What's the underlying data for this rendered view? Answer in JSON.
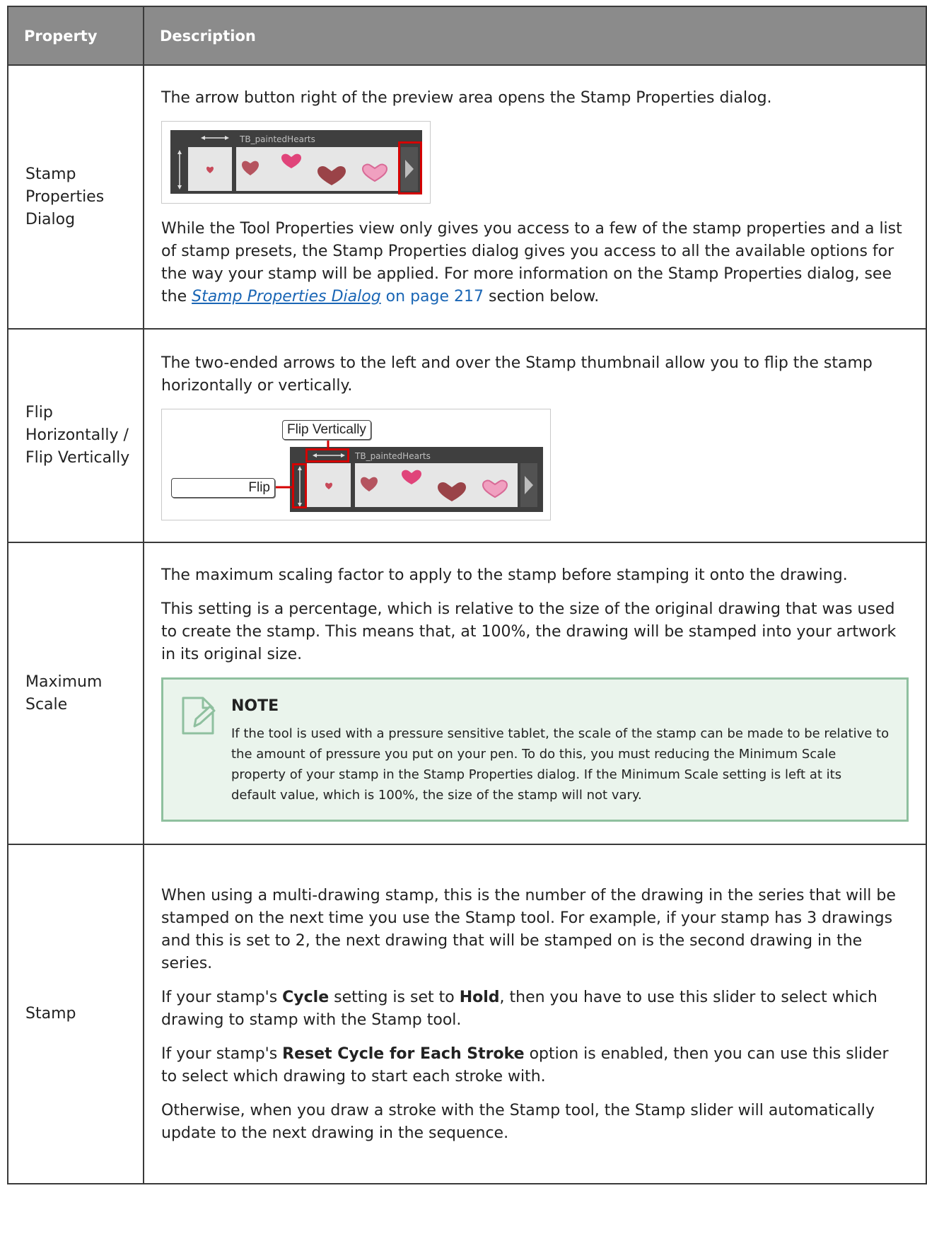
{
  "headers": {
    "property": "Property",
    "description": "Description"
  },
  "rows": [
    {
      "name": "Stamp Properties Dialog",
      "intro": "The arrow button right of the preview area opens the Stamp Properties dialog.",
      "figure_label": "TB_paintedHearts",
      "body_before_link": "While the Tool Properties view only gives you access to a few of the stamp properties and a list of stamp presets, the Stamp Properties dialog gives you access to all the available options for the way your stamp will be applied. For more information on the Stamp Properties dialog, see the ",
      "link_text": "Stamp Properties Dialog",
      "link_page": " on page 217",
      "body_after_link": " section below."
    },
    {
      "name": "Flip Horizontally / Flip Vertically",
      "intro": "The two-ended arrows to the left and over the Stamp thumbnail allow you to flip the stamp horizontally or vertically.",
      "figure_label": "TB_paintedHearts",
      "callout_vertical": "Flip Vertically",
      "callout_flip": "Flip"
    },
    {
      "name": "Maximum Scale",
      "p1": "The maximum scaling factor to apply to the stamp before stamping it onto the drawing.",
      "p2": "This setting is a percentage, which is relative to the size of the original drawing that was used to create the stamp. This means that, at 100%, the drawing will be stamped into your artwork in its original size.",
      "note_title": "NOTE",
      "note_body": "If the tool is used with a pressure sensitive tablet, the scale of the stamp can be made to be relative to the amount of pressure you put on your pen. To do this, you must reducing the Minimum Scale property of your stamp in the Stamp Properties dialog. If the Minimum Scale setting is left at its default value, which is 100%, the size of the stamp will not vary."
    },
    {
      "name": "Stamp",
      "p1": "When using a multi-drawing stamp, this is the number of the drawing in the series that will be stamped on the next time you use the Stamp tool. For example, if your stamp has 3 drawings and this is set to 2, the next drawing that will be stamped on is the second drawing in the series.",
      "p2_a": "If your stamp's ",
      "p2_b": "Cycle",
      "p2_c": " setting is set to ",
      "p2_d": "Hold",
      "p2_e": ", then you have to use this slider to select which drawing to stamp with the Stamp tool.",
      "p3_a": "If your stamp's ",
      "p3_b": "Reset Cycle for Each Stroke",
      "p3_c": " option is enabled, then you can use this slider to select which drawing to start each stroke with.",
      "p4": "Otherwise, when you draw a stroke with the Stamp tool, the Stamp slider will automatically update to the next drawing in the sequence."
    }
  ],
  "colors": {
    "header_bg": "#8b8b8b",
    "highlight": "#d40000",
    "note_border": "#8fc09f",
    "note_bg": "#eaf4ec",
    "link": "#1a66b5"
  }
}
